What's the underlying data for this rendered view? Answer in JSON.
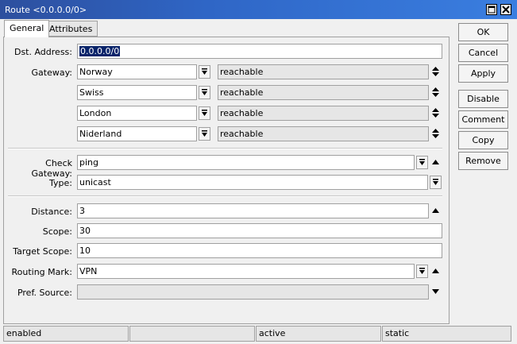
{
  "window": {
    "title": "Route <0.0.0.0/0>"
  },
  "tabs": [
    {
      "label": "General"
    },
    {
      "label": "Attributes"
    }
  ],
  "form": {
    "dst_address": {
      "label": "Dst. Address:",
      "value": "0.0.0.0/0"
    },
    "gateway": {
      "label": "Gateway:",
      "rows": [
        {
          "value": "Norway",
          "state": "reachable"
        },
        {
          "value": "Swiss",
          "state": "reachable"
        },
        {
          "value": "London",
          "state": "reachable"
        },
        {
          "value": "Niderland",
          "state": "reachable"
        }
      ]
    },
    "check_gateway": {
      "label": "Check Gateway:",
      "value": "ping"
    },
    "type": {
      "label": "Type:",
      "value": "unicast"
    },
    "distance": {
      "label": "Distance:",
      "value": "3"
    },
    "scope": {
      "label": "Scope:",
      "value": "30"
    },
    "target_scope": {
      "label": "Target Scope:",
      "value": "10"
    },
    "routing_mark": {
      "label": "Routing Mark:",
      "value": "VPN"
    },
    "pref_source": {
      "label": "Pref. Source:",
      "value": ""
    }
  },
  "buttons": {
    "ok": "OK",
    "cancel": "Cancel",
    "apply": "Apply",
    "disable": "Disable",
    "comment": "Comment",
    "copy": "Copy",
    "remove": "Remove"
  },
  "status": {
    "cell1": "enabled",
    "cell2": "",
    "cell3": "active",
    "cell4": "static"
  },
  "colors": {
    "titlebar": "#2f66c6",
    "selection": "#0a246a"
  },
  "icons": [
    "maximize-icon",
    "close-icon",
    "dropdown-icon",
    "up-down-arrow-icon",
    "up-arrow-icon",
    "down-arrow-icon"
  ]
}
